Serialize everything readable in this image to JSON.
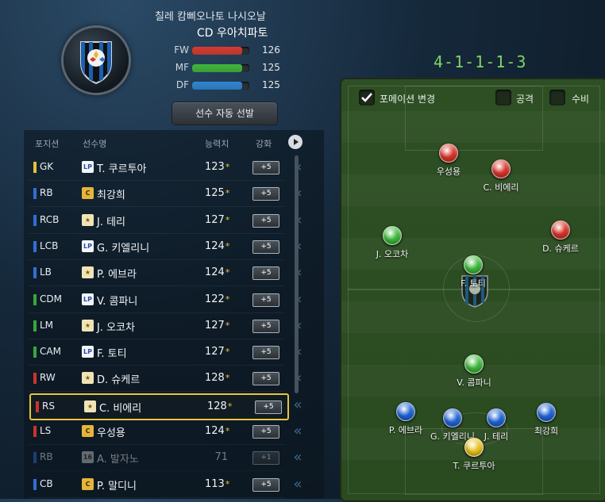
{
  "club": {
    "line1": "칠레 캄삐오나토 나시오날",
    "line2": "CD 우아치파토"
  },
  "stats": [
    {
      "label": "FW",
      "value": 126,
      "color": "#d93a2e",
      "fill": 0.88
    },
    {
      "label": "MF",
      "value": 125,
      "color": "#3fb83b",
      "fill": 0.87
    },
    {
      "label": "DF",
      "value": 125,
      "color": "#2e86d4",
      "fill": 0.87
    }
  ],
  "auto_select_label": "선수 자동 선발",
  "table": {
    "headers": {
      "position": "포지션",
      "name": "선수명",
      "rating": "능력치",
      "upgrade": "강화"
    },
    "rows": [
      {
        "pos": "GK",
        "poscolor": "#e3c23c",
        "badge": "LP",
        "name": "T. 쿠르투아",
        "rating": "123",
        "star": "*",
        "up": "+5"
      },
      {
        "pos": "RB",
        "poscolor": "#2f6fd6",
        "badge": "C",
        "name": "최강희",
        "rating": "125",
        "star": "*",
        "up": "+5"
      },
      {
        "pos": "RCB",
        "poscolor": "#2f6fd6",
        "badge": "★",
        "name": "J. 테리",
        "rating": "127",
        "star": "*",
        "up": "+5"
      },
      {
        "pos": "LCB",
        "poscolor": "#2f6fd6",
        "badge": "LP",
        "name": "G. 키엘리니",
        "rating": "124",
        "star": "*",
        "up": "+5"
      },
      {
        "pos": "LB",
        "poscolor": "#2f6fd6",
        "badge": "★",
        "name": "P. 에브라",
        "rating": "124",
        "star": "*",
        "up": "+5"
      },
      {
        "pos": "CDM",
        "poscolor": "#38a83a",
        "badge": "LP",
        "name": "V. 콤파니",
        "rating": "122",
        "star": "*",
        "up": "+5"
      },
      {
        "pos": "LM",
        "poscolor": "#38a83a",
        "badge": "★",
        "name": "J. 오코차",
        "rating": "127",
        "star": "*",
        "up": "+5"
      },
      {
        "pos": "CAM",
        "poscolor": "#38a83a",
        "badge": "LP",
        "name": "F. 토티",
        "rating": "127",
        "star": "*",
        "up": "+5"
      },
      {
        "pos": "RW",
        "poscolor": "#c9342c",
        "badge": "★",
        "name": "D. 슈케르",
        "rating": "128",
        "star": "*",
        "up": "+5"
      },
      {
        "pos": "RS",
        "poscolor": "#c9342c",
        "badge": "★",
        "name": "C. 비에리",
        "rating": "128",
        "star": "*",
        "up": "+5"
      },
      {
        "pos": "LS",
        "poscolor": "#c9342c",
        "badge": "C",
        "name": "우성용",
        "rating": "124",
        "star": "*",
        "up": "+5"
      },
      {
        "pos": "RB",
        "poscolor": "#2f6fd6",
        "badge": "16",
        "name": "A. 발자노",
        "rating": "71",
        "star": "",
        "up": "+1"
      },
      {
        "pos": "CB",
        "poscolor": "#2f6fd6",
        "badge": "C",
        "name": "P. 말디니",
        "rating": "113",
        "star": "*",
        "up": "+5"
      }
    ]
  },
  "formation": "4-1-1-1-3",
  "pitch_controls": {
    "change_label": "포메이션 변경",
    "attack_label": "공격",
    "defense_label": "수비"
  },
  "pitch_players": [
    {
      "name": "우성용",
      "color": "#d8342a"
    },
    {
      "name": "C. 비에리",
      "color": "#d8342a"
    },
    {
      "name": "J. 오코차",
      "color": "#3cb83a"
    },
    {
      "name": "D. 슈케르",
      "color": "#d8342a"
    },
    {
      "name": "F. 토티",
      "color": "#3cb83a"
    },
    {
      "name": "V. 콤파니",
      "color": "#3cb83a"
    },
    {
      "name": "P. 에브라",
      "color": "#1f63d4"
    },
    {
      "name": "G. 키엘리니",
      "color": "#1f63d4"
    },
    {
      "name": "J. 테리",
      "color": "#1f63d4"
    },
    {
      "name": "최강희",
      "color": "#1f63d4"
    },
    {
      "name": "T. 쿠르투아",
      "color": "#e8c21e"
    }
  ]
}
